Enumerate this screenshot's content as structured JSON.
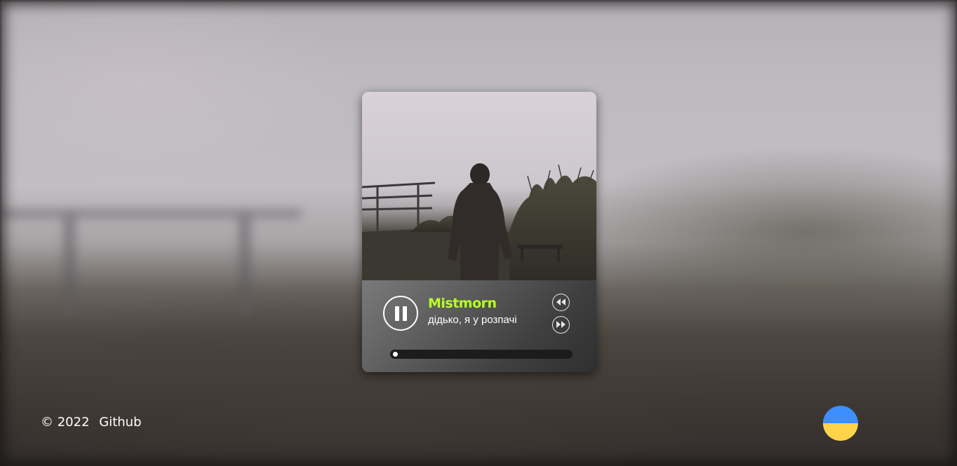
{
  "player": {
    "artist": "Mistmorn",
    "track": "дідько, я у розпачі",
    "state": "playing",
    "progress_fraction": 0.01,
    "icons": {
      "play_pause": "pause-icon",
      "previous": "rewind-icon",
      "next": "fast-forward-icon"
    }
  },
  "footer": {
    "copyright": "© 2022",
    "link_label": "Github"
  },
  "flag": {
    "name": "ukraine-flag",
    "colors": {
      "top": "#3d8eff",
      "bottom": "#ffd34a"
    }
  },
  "colors": {
    "accent": "#b8ff24",
    "text": "#ffffff",
    "progress_track": "#1c1c1c"
  }
}
